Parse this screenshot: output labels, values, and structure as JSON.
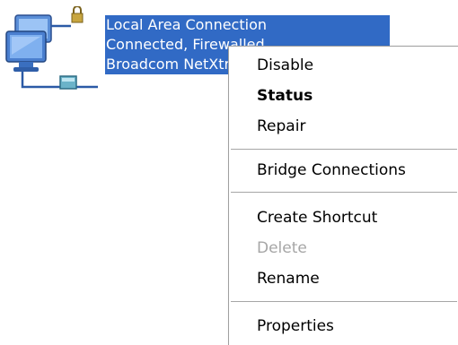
{
  "connection": {
    "name": "Local Area Connection",
    "status": "Connected, Firewalled",
    "device": "Broadcom NetXtreme Gigabit Ethernet",
    "icon": "network-connection-icon"
  },
  "menu": {
    "disable": "Disable",
    "status": "Status",
    "repair": "Repair",
    "bridge": "Bridge Connections",
    "create_shortcut": "Create Shortcut",
    "delete": "Delete",
    "rename": "Rename",
    "properties": "Properties"
  },
  "colors": {
    "selection": "#316ac5",
    "disabled_text": "#a6a6a6"
  }
}
